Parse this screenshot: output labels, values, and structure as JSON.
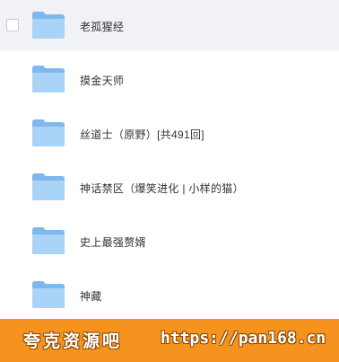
{
  "files": [
    {
      "name": "老孤猩经",
      "type": "folder"
    },
    {
      "name": "摸金天师",
      "type": "folder"
    },
    {
      "name": "丝道士（原野）[共491回]",
      "type": "folder"
    },
    {
      "name": "神话禁区（爆笑进化 | 小样的猫）",
      "type": "folder"
    },
    {
      "name": "史上最强赘婿",
      "type": "folder"
    },
    {
      "name": "神藏",
      "type": "folder"
    }
  ],
  "watermark": {
    "site_name": "夸克资源吧",
    "url": "https://pan168.cn"
  },
  "colors": {
    "folder_back": "#7fb8ec",
    "folder_front": "#a9d3f7",
    "hover_row": "#f0f2f5",
    "watermark_bg": "#f6921e"
  }
}
